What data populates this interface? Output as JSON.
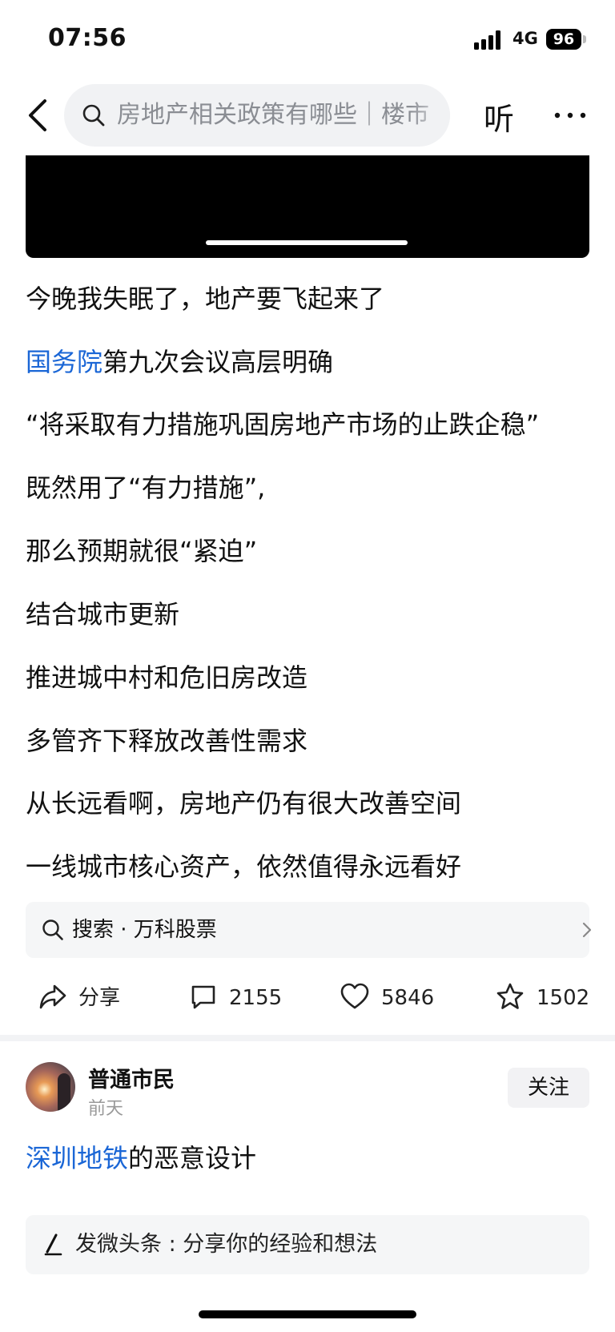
{
  "status_bar": {
    "time": "07:56",
    "network": "4G",
    "battery": "96"
  },
  "nav": {
    "search_text": "房地产相关政策有哪些｜楼市",
    "listen_label": "听"
  },
  "article": {
    "line1": "今晚我失眠了，地产要飞起来了",
    "line2_link": "国务院",
    "line2_rest": "第九次会议高层明确",
    "line3": "“将采取有力措施巩固房地产市场的止跌企稳”",
    "line4": "既然用了“有力措施”,",
    "line5": "那么预期就很“紧迫”",
    "line6": "结合城市更新",
    "line7": "推进城中村和危旧房改造",
    "line8": "多管齐下释放改善性需求",
    "line9": "从长远看啊，房地产仍有很大改善空间",
    "line10": "一线城市核心资产，依然值得永远看好"
  },
  "suggestion": {
    "label": "搜索 · 万科股票"
  },
  "actions": {
    "share_label": "分享",
    "comment_count": "2155",
    "like_count": "5846",
    "favorite_count": "1502"
  },
  "next_post": {
    "username": "普通市民",
    "time": "前天",
    "follow_label": "关注",
    "title_link": "深圳地铁",
    "title_rest": "的恶意设计"
  },
  "composer": {
    "placeholder": "发微头条 : 分享你的经验和想法"
  },
  "colors": {
    "link": "#1a66d6",
    "text": "#111111",
    "muted": "#999999",
    "panel": "#f5f6f7"
  },
  "icons": {
    "back": "chevron-left-icon",
    "search": "search-icon",
    "more": "more-dots-icon",
    "share": "share-arrow-icon",
    "comment": "comment-bubble-icon",
    "like": "heart-icon",
    "favorite": "star-icon",
    "pen": "pen-icon",
    "chevron": "chevron-right-icon"
  }
}
